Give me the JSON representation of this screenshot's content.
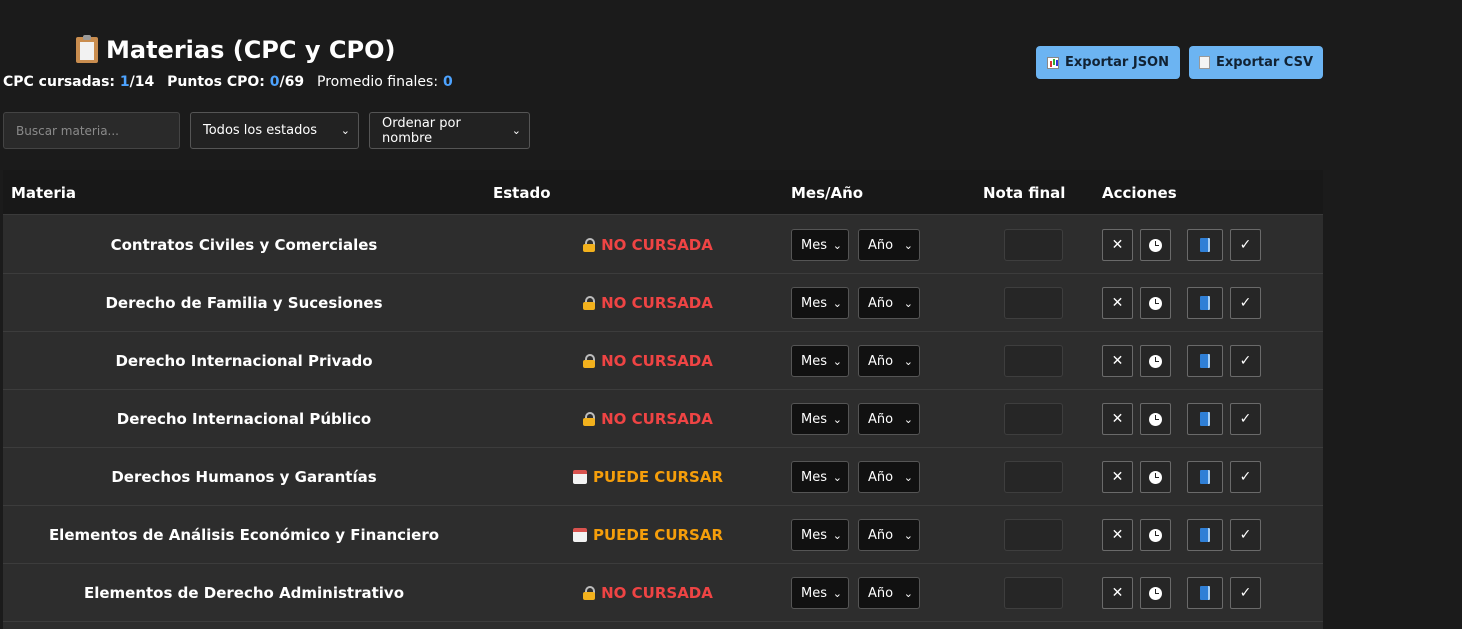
{
  "header": {
    "title": "Materias (CPC y CPO)",
    "stats": {
      "cpc_label": "CPC cursadas:",
      "cpc_done": "1",
      "cpc_total": "/14",
      "cpo_label": "Puntos CPO:",
      "cpo_done": "0",
      "cpo_total": "/69",
      "avg_label": "Promedio finales:",
      "avg_value": "0"
    },
    "export_json_label": "Exportar JSON",
    "export_csv_label": "Exportar CSV"
  },
  "filters": {
    "search_placeholder": "Buscar materia...",
    "estado_selected": "Todos los estados",
    "orden_selected": "Ordenar por nombre"
  },
  "table": {
    "columns": {
      "materia": "Materia",
      "estado": "Estado",
      "mes_ano": "Mes/Año",
      "nota_final": "Nota final",
      "acciones": "Acciones"
    },
    "mes_placeholder": "Mes",
    "ano_placeholder": "Año",
    "actions": {
      "close": "✕",
      "check": "✓"
    },
    "rows": [
      {
        "name": "Contratos Civiles y Comerciales",
        "status": "NO CURSADA",
        "status_icon": "lock-icon"
      },
      {
        "name": "Derecho de Familia y Sucesiones",
        "status": "NO CURSADA",
        "status_icon": "lock-icon"
      },
      {
        "name": "Derecho Internacional Privado",
        "status": "NO CURSADA",
        "status_icon": "lock-icon"
      },
      {
        "name": "Derecho Internacional Público",
        "status": "NO CURSADA",
        "status_icon": "lock-icon"
      },
      {
        "name": "Derechos Humanos y Garantías",
        "status": "PUEDE CURSAR",
        "status_icon": "calendar-icon"
      },
      {
        "name": "Elementos de Análisis Económico y Financiero",
        "status": "PUEDE CURSAR",
        "status_icon": "calendar-icon"
      },
      {
        "name": "Elementos de Derecho Administrativo",
        "status": "NO CURSADA",
        "status_icon": "lock-icon"
      }
    ]
  },
  "colors": {
    "no_cursada": "#ef4444",
    "puede_cursar": "#f59e0b",
    "accent": "#4da3ff",
    "button_bg": "#6cb4f2"
  }
}
